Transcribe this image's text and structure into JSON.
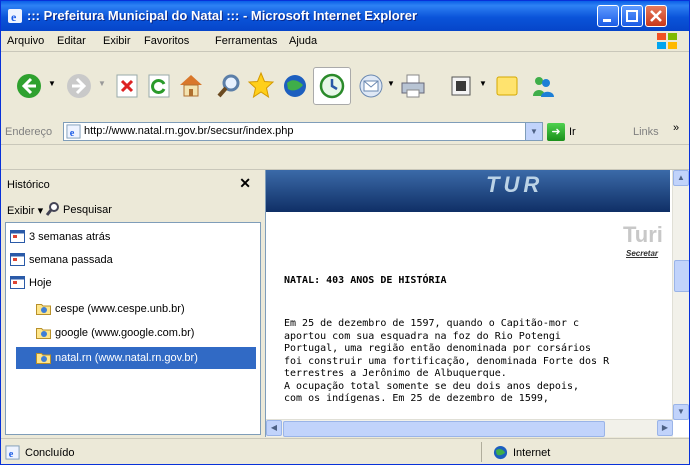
{
  "window": {
    "title": "::: Prefeitura Municipal do Natal ::: - Microsoft Internet Explorer"
  },
  "menu": [
    "Arquivo",
    "Editar",
    "Exibir",
    "Favoritos",
    "Ferramentas",
    "Ajuda"
  ],
  "toolbar_icons": [
    "back-icon",
    "forward-icon",
    "stop-icon",
    "refresh-icon",
    "home-icon",
    "search-icon",
    "favorites-icon",
    "media-icon",
    "history-icon",
    "mail-icon",
    "print-icon",
    "edit-icon",
    "discuss-icon",
    "messenger-icon"
  ],
  "address": {
    "label": "Endereço",
    "url": "http://www.natal.rn.gov.br/secsur/index.php",
    "go_label": "Ir",
    "links_label": "Links"
  },
  "sidebar": {
    "title": "Histórico",
    "view_label": "Exibir",
    "search_label": "Pesquisar",
    "items": [
      {
        "label": "3 semanas atrás",
        "level": 0,
        "selected": false
      },
      {
        "label": "semana passada",
        "level": 0,
        "selected": false
      },
      {
        "label": "Hoje",
        "level": 0,
        "selected": false
      },
      {
        "label": "cespe (www.cespe.unb.br)",
        "level": 1,
        "selected": false
      },
      {
        "label": "google (www.google.com.br)",
        "level": 1,
        "selected": false
      },
      {
        "label": "natal.rn (www.natal.rn.gov.br)",
        "level": 1,
        "selected": true
      }
    ]
  },
  "page": {
    "banner_text": "TUR",
    "logo_text": "Turi",
    "logo_sub": "Secretar",
    "heading": "NATAL: 403 ANOS DE HISTÓRIA",
    "paragraph_lines": [
      "Em 25 de dezembro de 1597, quando o Capitão-mor c",
      "aportou com sua esquadra na foz do Rio Potengi",
      "Portugal, uma região então denominada por corsários",
      "foi construir uma fortificação, denominada Forte dos R",
      "terrestres a Jerônimo de Albuquerque.",
      "A ocupação total somente se deu dois anos depois,",
      "com os indígenas. Em 25 de dezembro de 1599,"
    ]
  },
  "status": {
    "text": "Concluído",
    "zone": "Internet"
  }
}
